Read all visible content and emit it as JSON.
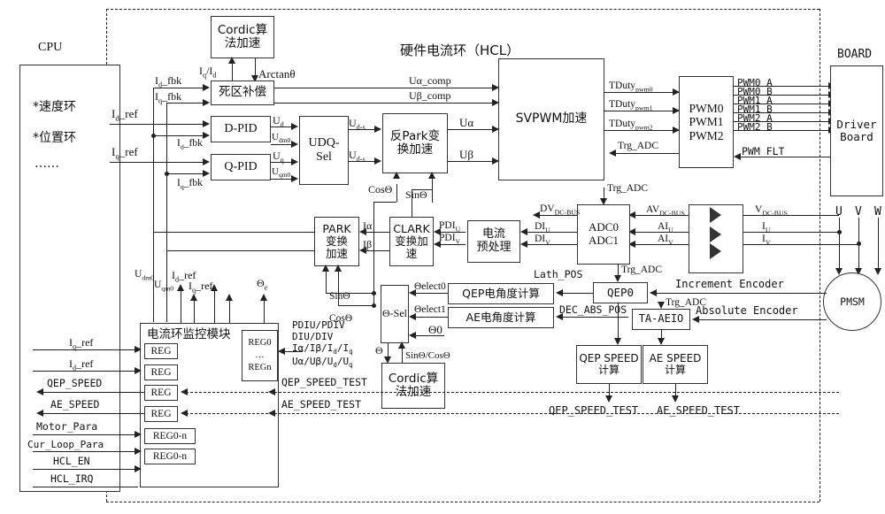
{
  "diagram": {
    "title": "硬件电流环（HCL）",
    "regions": {
      "cpu": "CPU",
      "board": "BOARD"
    }
  },
  "cpu_panel": {
    "items": [
      "*速度环",
      "*位置环",
      "……"
    ]
  },
  "blocks": {
    "cordic_top": "Cordic算\n法加速",
    "deadzone": "死区补偿",
    "d_pid": "D-PID",
    "q_pid": "Q-PID",
    "udq_sel": "UDQ-\nSel",
    "inv_park": "反Park变\n换加速",
    "svpwm": "SVPWM加速",
    "pwm": "PWM0\nPWM1\nPWM2",
    "driver_board": "Driver\nBoard",
    "adc": "ADC0\nADC1",
    "current_pre": "电流\n预处理",
    "clark": "CLARK\n变换加\n速",
    "park": "PARK\n变换\n加速",
    "theta_sel": "Θ-Sel",
    "cordic_bottom": "Cordic算\n法加速",
    "qep_angle": "QEP电角度计算",
    "ae_angle": "AE电角度计算",
    "qep0": "QEP0",
    "ta_aeio": "TA-AEIO",
    "qep_speed_calc": "QEP SPEED\n计算",
    "ae_speed_calc": "AE SPEED\n计算",
    "monitor": "电流环监控模块",
    "pmsm": "PMSM",
    "reg_stack": "REG0\n…\nREGn"
  },
  "monitor_regs": [
    "REG",
    "REG",
    "REG",
    "REG",
    "REG0-n",
    "REG0-n"
  ],
  "signals": {
    "id_fbk": "I<sub>d</sub>_fbk",
    "iq_fbk": "I<sub>q</sub>_fbk",
    "id_ref": "I<sub>d</sub>_ref",
    "iq_ref": "I<sub>q</sub>_ref",
    "iq_id": "I<sub>q</sub>/I<sub>d</sub>",
    "arctan": "Arctanθ",
    "ua_comp": "Uα_comp",
    "ub_comp": "Uβ_comp",
    "ud": "U<sub>d</sub>",
    "udm0": "U<sub>dm0</sub>",
    "uq": "U<sub>q</sub>",
    "uqm0": "U<sub>qm0</sub>",
    "ud_s1": "U<sub>d-s</sub>",
    "ud_s2": "U<sub>d-s</sub>",
    "ualpha": "Uα",
    "ubeta": "Uβ",
    "cos_theta": "CosΘ",
    "sin_theta": "SinΘ",
    "tduty0": "TDuty<sub>pwm0</sub>",
    "tduty1": "TDuty<sub>pwm1</sub>",
    "tduty2": "TDuty<sub>pwm2</sub>",
    "trg_adc": "Trg_ADC",
    "pwm_flt": "PWM_FLT",
    "pwm_lines": [
      "PWM0  A",
      "PWM0  B",
      "PWM1  A",
      "PWM1  B",
      "PWM2  A",
      "PWM2  B"
    ],
    "dv_dcbus": "DV<sub>DC-BUS</sub>",
    "av_dcbus": "AV<sub>DC-BUS</sub>",
    "v_dcbus": "V<sub>DC-BUS</sub>",
    "di_u": "DI<sub>U</sub>",
    "di_v": "DI<sub>V</sub>",
    "ai_u": "AI<sub>U</sub>",
    "ai_v": "AI<sub>V</sub>",
    "i_u": "I<sub>U</sub>",
    "i_v": "I<sub>V</sub>",
    "pdi_u": "PDI<sub>U</sub>",
    "pdi_v": "PDI<sub>V</sub>",
    "i_alpha": "Iα",
    "i_beta": "Iβ",
    "theta_elect0": "Θelect0",
    "theta_elect1": "Θelect1",
    "theta_0": "Θ0",
    "theta": "Θ",
    "theta_e": "Θ<sub>e</sub>",
    "sin_cos": "SinΘ/CosΘ",
    "lath_pos": "Lath_POS",
    "dec_abs_pos": "DEC_ABS_POS",
    "increment_encoder": "Increment Encoder",
    "absolute_encoder": "Absolute Encoder",
    "uvw": [
      "U",
      "V",
      "W"
    ],
    "qep_speed_test": "QEP_SPEED_TEST",
    "ae_speed_test": "AE_SPEED_TEST",
    "monitor_inputs": [
      "I<sub>q</sub>_ref",
      "I<sub>d</sub>_ref",
      "QEP_SPEED",
      "AE_SPEED",
      "Motor_Para",
      "Cur_Loop_Para",
      "HCL_EN",
      "HCL_IRQ"
    ],
    "monitor_top": [
      "U<sub>dm0</sub>",
      "U<sub>qm0</sub>",
      "I<sub>d</sub>_ref",
      "I<sub>q</sub>_ref",
      "Θ<sub>e</sub>"
    ],
    "reg_side": "PDIU/PDIV\nDIU/DIV\nIα/Iβ/Id/Iq\nUα/Uβ/Ud/Uq"
  },
  "colors": {
    "stroke": "#222222",
    "background": "#ffffff"
  }
}
